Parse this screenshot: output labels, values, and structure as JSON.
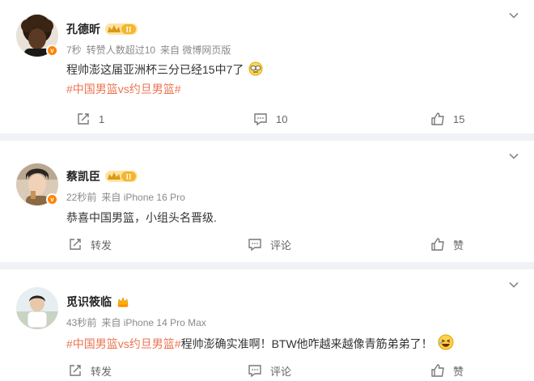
{
  "posts": [
    {
      "user": "孔德昕",
      "level": "II",
      "time": "7秒",
      "repost_info": "转赞人数超过10",
      "source": "来自 微博网页版",
      "text": "程帅澎这届亚洲杯三分已经15中7了",
      "topic": "#中国男篮vs约旦男篮#",
      "repost": "1",
      "comment": "10",
      "like": "15",
      "emoji_icon": "awkward-face-emoji-icon"
    },
    {
      "user": "蔡凯臣",
      "level": "II",
      "time": "22秒前",
      "source": "来自 iPhone 16 Pro",
      "text": "恭喜中国男篮，小组头名晋级.",
      "repost": "转发",
      "comment": "评论",
      "like": "赞"
    },
    {
      "user": "觅识筱临",
      "time": "43秒前",
      "source": "来自 iPhone 14 Pro Max",
      "topic": "#中国男篮vs约旦男篮#",
      "text": "程帅澎确实准啊！BTW他咋越来越像青筋弟弟了！",
      "repost": "转发",
      "comment": "评论",
      "like": "赞",
      "emoji_icon": "laughing-face-emoji-icon"
    }
  ],
  "colors": {
    "topic": "#eb7350",
    "verified": "#ff8200",
    "background": "#f1f2f5"
  },
  "icons": [
    "chevron-down-icon",
    "repost-icon",
    "comment-icon",
    "like-icon",
    "verified-badge-icon",
    "level-badge-icon"
  ]
}
